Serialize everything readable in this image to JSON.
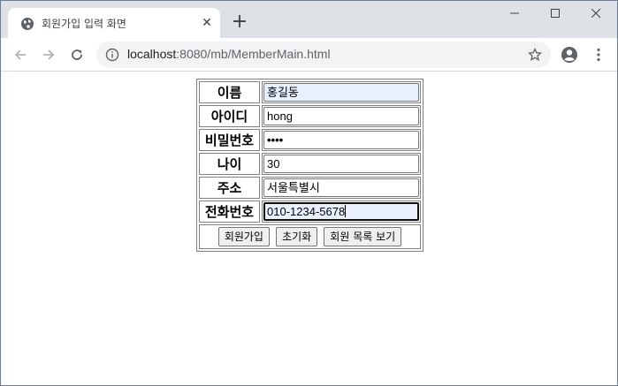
{
  "browser": {
    "tab_title": "회원가입 입력 화면",
    "tab_close": "✕",
    "new_tab": "+",
    "url_host": "localhost",
    "url_rest": ":8080/mb/MemberMain.html",
    "icons": {
      "favicon": "globe-icon",
      "back": "arrow-left-icon",
      "forward": "arrow-right-icon",
      "reload": "reload-icon",
      "info": "info-icon",
      "bookmark": "star-icon",
      "profile": "profile-icon",
      "menu": "kebab-menu-icon"
    }
  },
  "form": {
    "rows": [
      {
        "label": "이름",
        "value": "홍길동"
      },
      {
        "label": "아이디",
        "value": "hong"
      },
      {
        "label": "비밀번호",
        "value": "••••"
      },
      {
        "label": "나이",
        "value": "30"
      },
      {
        "label": "주소",
        "value": "서울특별시"
      },
      {
        "label": "전화번호",
        "value": "010-1234-5678"
      }
    ],
    "buttons": {
      "submit": "회원가입",
      "reset": "초기화",
      "list": "회원 목록 보기"
    }
  },
  "colors": {
    "tabstrip": "#dee1e6",
    "omnibox": "#f1f3f4",
    "autofill": "#e8f0fe",
    "button": "#efefef"
  }
}
